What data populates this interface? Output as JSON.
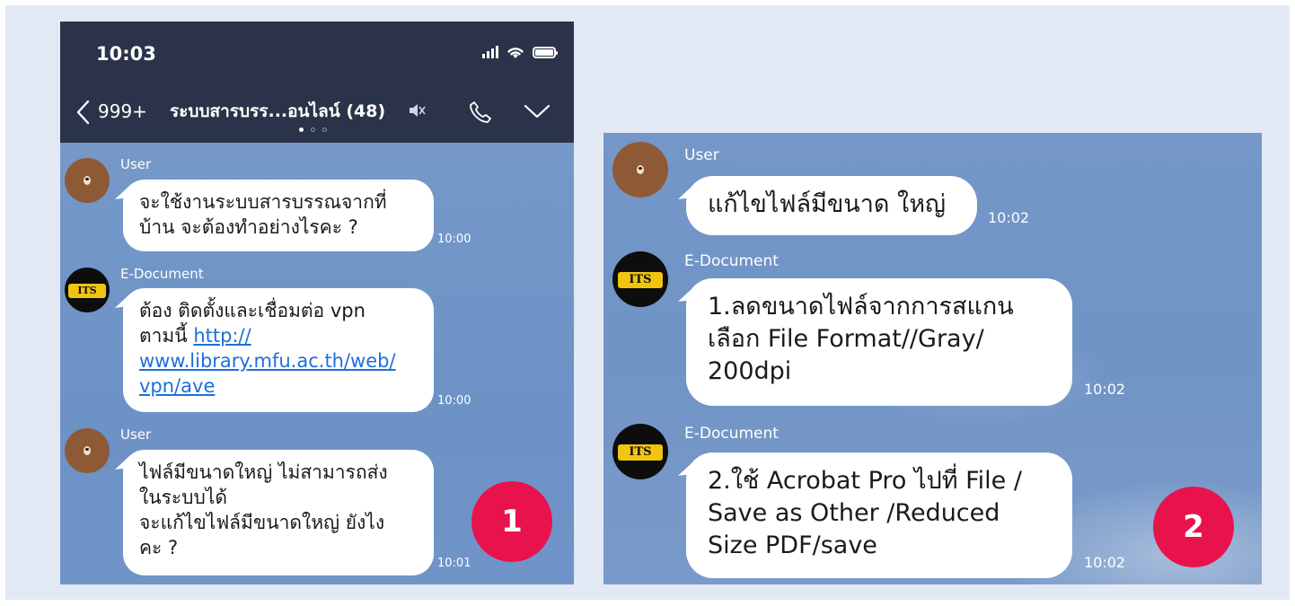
{
  "panel1": {
    "status_time": "10:03",
    "back_count": "999+",
    "chat_title": "ระบบสารบรร...อนไลน์ (48)",
    "messages": [
      {
        "sender": "User",
        "lines": [
          "จะใช้งานระบบสารบรรณจากที่",
          "บ้าน จะต้องทำอย่างไรคะ ?"
        ],
        "time": "10:00"
      },
      {
        "sender": "E-Document",
        "line1": "ต้อง ติดตั้งและเชื่อมต่อ vpn",
        "line2_text": "ตามนี้ ",
        "link_lines": [
          "http://",
          "www.library.mfu.ac.th/web/",
          "vpn/ave"
        ],
        "time": "10:00"
      },
      {
        "sender": "User",
        "lines": [
          "ไฟล์มีขนาดใหญ่ ไม่สามารถส่ง",
          "ในระบบได้",
          "จะแก้ไขไฟล์มีขนาดใหญ่ ยังไง",
          "คะ ?"
        ],
        "time": "10:01"
      }
    ],
    "badge": "1"
  },
  "panel2": {
    "messages": [
      {
        "sender": "User",
        "lines": [
          "แก้ไขไฟล์มีขนาด ใหญ่"
        ],
        "time": "10:02"
      },
      {
        "sender": "E-Document",
        "lines": [
          "1.ลดขนาดไฟล์จากการสแกน",
          "เลือก File Format//Gray/",
          "200dpi"
        ],
        "time": "10:02"
      },
      {
        "sender": "E-Document",
        "lines": [
          "2.ใช้ Acrobat Pro ไปที่ File /",
          "Save as Other /Reduced",
          "Size PDF/save"
        ],
        "time": "10:02"
      }
    ],
    "badge": "2"
  },
  "logo_text": "ITS",
  "colors": {
    "header_bg": "#2a3349",
    "chat_bg": "#7397c8",
    "badge": "#e8134d",
    "link": "#1e6fd8"
  },
  "icons": [
    "back-chevron-icon",
    "mute-icon",
    "phone-call-icon",
    "chevron-down-icon",
    "signal-icon",
    "wifi-icon",
    "battery-icon"
  ]
}
